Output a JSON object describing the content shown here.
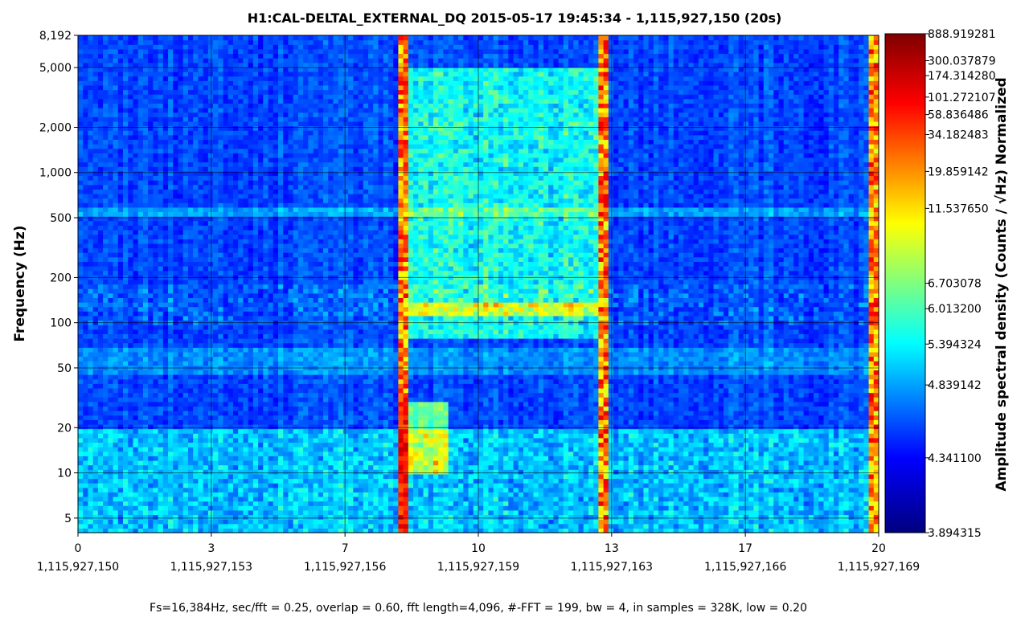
{
  "chart_data": {
    "type": "heatmap",
    "title": "H1:CAL-DELTAL_EXTERNAL_DQ 2015-05-17 19:45:34 - 1,115,927,150 (20s)",
    "ylabel": "Frequency (Hz)",
    "colorbar_label": "Amplitude spectral density (Counts / √Hz) Normalized",
    "footer": "Fs=16,384Hz, sec/fft = 0.25, overlap = 0.60, fft length=4,096, #-FFT = 199, bw = 4, in samples = 328K, low = 0.20",
    "xlim": [
      0,
      20
    ],
    "ylim": [
      4,
      8192
    ],
    "y_scale": "log",
    "x_ticks": [
      {
        "value": 0,
        "label": "0",
        "gps": "1,115,927,150"
      },
      {
        "value": 3.33,
        "label": "3",
        "gps": "1,115,927,153"
      },
      {
        "value": 6.67,
        "label": "7",
        "gps": "1,115,927,156"
      },
      {
        "value": 10,
        "label": "10",
        "gps": "1,115,927,159"
      },
      {
        "value": 13.33,
        "label": "13",
        "gps": "1,115,927,163"
      },
      {
        "value": 16.67,
        "label": "17",
        "gps": "1,115,927,166"
      },
      {
        "value": 20,
        "label": "20",
        "gps": "1,115,927,169"
      }
    ],
    "y_ticks": [
      {
        "value": 5,
        "label": "5"
      },
      {
        "value": 10,
        "label": "10"
      },
      {
        "value": 20,
        "label": "20"
      },
      {
        "value": 50,
        "label": "50"
      },
      {
        "value": 100,
        "label": "100"
      },
      {
        "value": 200,
        "label": "200"
      },
      {
        "value": 500,
        "label": "500"
      },
      {
        "value": 1000,
        "label": "1,000"
      },
      {
        "value": 2000,
        "label": "2,000"
      },
      {
        "value": 5000,
        "label": "5,000"
      },
      {
        "value": 8192,
        "label": "8,192"
      }
    ],
    "colorbar_ticks": [
      {
        "frac": 1.0,
        "label": "888.919281"
      },
      {
        "frac": 0.946,
        "label": "300.037879"
      },
      {
        "frac": 0.916,
        "label": "174.314280"
      },
      {
        "frac": 0.873,
        "label": "101.272107"
      },
      {
        "frac": 0.838,
        "label": "58.836486"
      },
      {
        "frac": 0.798,
        "label": "34.182483"
      },
      {
        "frac": 0.724,
        "label": "19.859142"
      },
      {
        "frac": 0.65,
        "label": "11.537650"
      },
      {
        "frac": 0.5,
        "label": "6.703078"
      },
      {
        "frac": 0.449,
        "label": "6.013200"
      },
      {
        "frac": 0.378,
        "label": "5.394324"
      },
      {
        "frac": 0.296,
        "label": "4.839142"
      },
      {
        "frac": 0.15,
        "label": "4.341100"
      },
      {
        "frac": 0.0,
        "label": "3.894315"
      }
    ],
    "colormap": [
      "#00007f",
      "#0000ff",
      "#00ffff",
      "#ffff00",
      "#ff0000",
      "#7f0000"
    ],
    "grid": true,
    "events": [
      {
        "label": "broadband transient",
        "t": 8.1
      },
      {
        "label": "broadband transient",
        "t": 13.15
      },
      {
        "label": "broadband transient",
        "t": 19.9
      }
    ],
    "excess_power_region": {
      "t_start": 8.2,
      "t_end": 13.1,
      "f_low": 80,
      "f_high": 5000
    },
    "low_freq_burst": {
      "t_start": 8.2,
      "t_end": 9.2,
      "f_low": 10,
      "f_high": 30
    }
  }
}
